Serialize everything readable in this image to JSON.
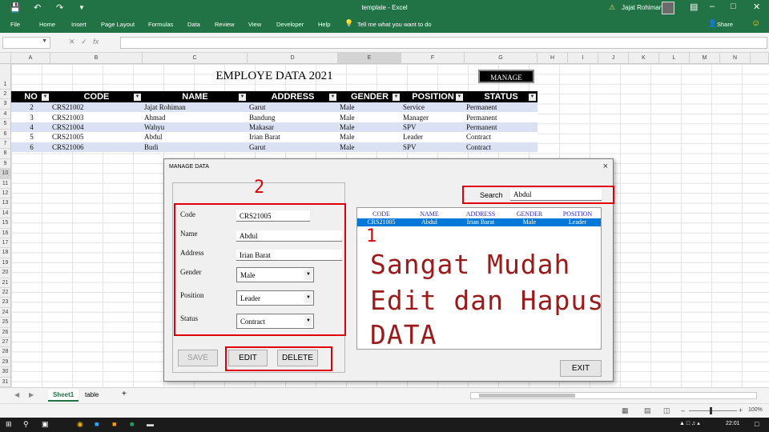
{
  "app": {
    "title": "template  -  Excel",
    "user": "Jajat Rohiman",
    "share": "Share"
  },
  "ribbon": {
    "tabs": [
      "File",
      "Home",
      "Insert",
      "Page Layout",
      "Formulas",
      "Data",
      "Review",
      "View",
      "Developer",
      "Help"
    ],
    "tell_me": "Tell me what you want to do"
  },
  "columns": [
    "A",
    "B",
    "C",
    "D",
    "E",
    "F",
    "G",
    "H",
    "I",
    "J",
    "K",
    "L",
    "M",
    "N"
  ],
  "rows": [
    "1",
    "2",
    "3",
    "4",
    "5",
    "6",
    "7",
    "8",
    "9",
    "10",
    "11",
    "12",
    "13",
    "14",
    "15",
    "16",
    "17",
    "18",
    "19",
    "20",
    "21",
    "22",
    "23",
    "24",
    "25",
    "26",
    "27",
    "28",
    "29",
    "30",
    "31"
  ],
  "sheet": {
    "title": "EMPLOYE DATA 2021",
    "manage_button": "MANAGE",
    "headers": [
      "NO",
      "CODE",
      "NAME",
      "ADDRESS",
      "GENDER",
      "POSITION",
      "STATUS"
    ],
    "data": [
      [
        "2",
        "CRS21002",
        "Jajat Rohiman",
        "Garut",
        "Male",
        "Service",
        "Permanent"
      ],
      [
        "3",
        "CRS21003",
        "Ahmad",
        "Bandung",
        "Male",
        "Manager",
        "Permanent"
      ],
      [
        "4",
        "CRS21004",
        "Wahyu",
        "Makasar",
        "Male",
        "SPV",
        "Permanent"
      ],
      [
        "5",
        "CRS21005",
        "Abdul",
        "Irian Barat",
        "Male",
        "Leader",
        "Contract"
      ],
      [
        "6",
        "CRS21006",
        "Budi",
        "Garut",
        "Male",
        "SPV",
        "Contract"
      ]
    ]
  },
  "sheet_tabs": {
    "active": "Sheet1",
    "other": "table",
    "add": "+"
  },
  "status": {
    "zoom": "100%"
  },
  "taskbar": {
    "time": "22:01"
  },
  "dialog": {
    "title": "MANAGE DATA",
    "close": "×",
    "labels": {
      "code": "Code",
      "name": "Name",
      "address": "Address",
      "gender": "Gender",
      "position": "Position",
      "status": "Status"
    },
    "values": {
      "code": "CRS21005",
      "name": "Abdul",
      "address": "Irian Barat",
      "gender": "Male",
      "position": "Leader",
      "status": "Contract"
    },
    "buttons": {
      "save": "SAVE",
      "edit": "EDIT",
      "delete": "DELETE",
      "exit": "EXIT"
    },
    "search": {
      "label": "Search",
      "value": "Abdul"
    },
    "list": {
      "headers": [
        "CODE",
        "NAME",
        "ADDRESS",
        "GENDER",
        "POSITION"
      ],
      "rows": [
        [
          "CRS21005",
          "Abdul",
          "Irian Barat",
          "Male",
          "Leader"
        ]
      ]
    },
    "annotations": {
      "num1": "1",
      "num2": "2",
      "promo_line1": "Sangat Mudah",
      "promo_line2": "Edit dan Hapus",
      "promo_line3": "DATA"
    }
  },
  "colors": {
    "excel_green": "#217346",
    "annotation_red": "#e00000",
    "promo_red": "#9b1a1a",
    "row_band": "#d9e1f2",
    "selection_blue": "#0078d7"
  }
}
